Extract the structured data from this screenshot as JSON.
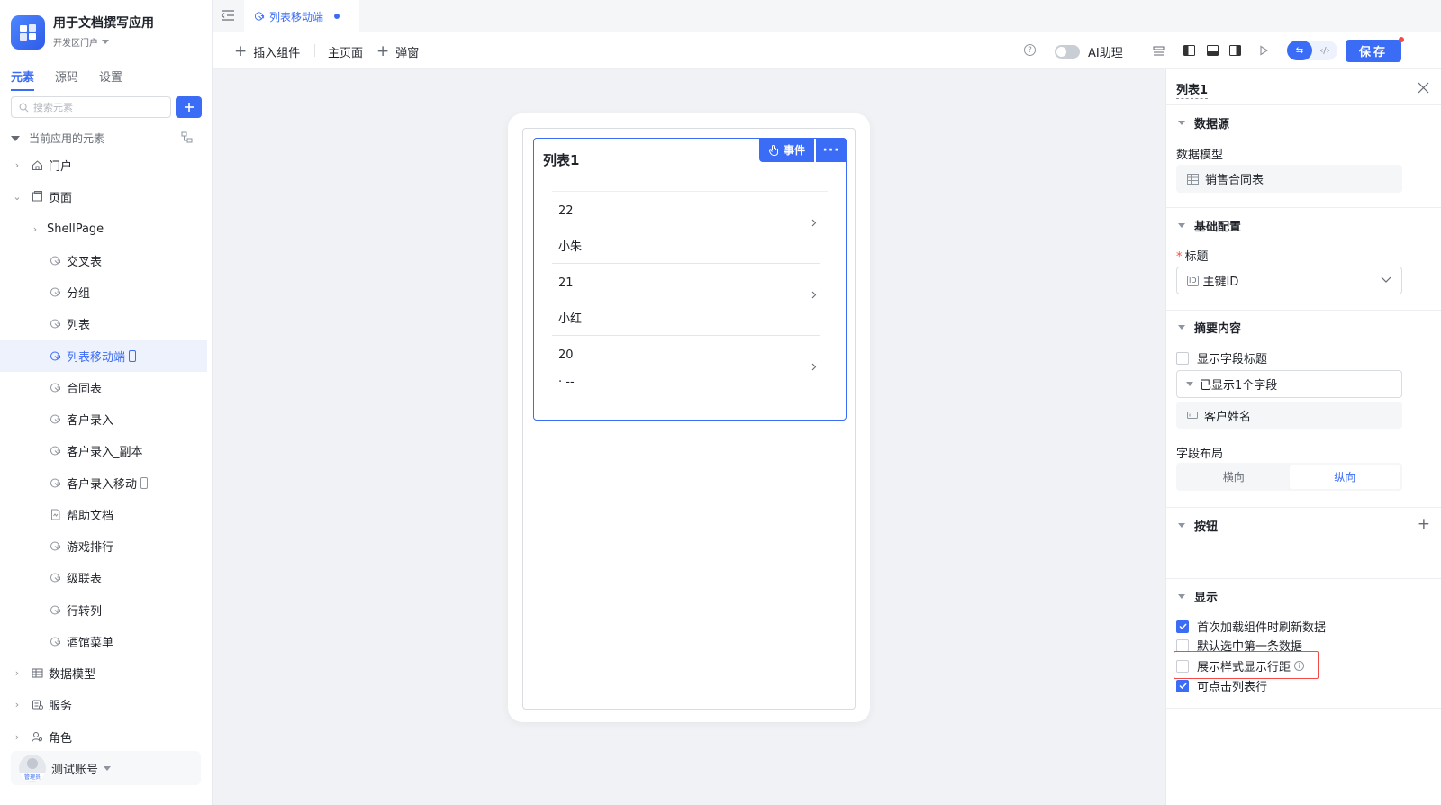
{
  "app": {
    "title": "用于文档撰写应用",
    "env": "开发区门户"
  },
  "sidebar": {
    "tabs": [
      "元素",
      "源码",
      "设置"
    ],
    "search_placeholder": "搜索元素",
    "section_label": "当前应用的元素",
    "items": [
      {
        "label": "门户",
        "icon": "home-icon"
      },
      {
        "label": "页面",
        "icon": "page-icon"
      },
      {
        "label": "ShellPage",
        "icon": ""
      },
      {
        "label": "交叉表",
        "icon": "page-leaf-icon"
      },
      {
        "label": "分组",
        "icon": "page-leaf-icon"
      },
      {
        "label": "列表",
        "icon": "page-leaf-icon"
      },
      {
        "label": "列表移动端",
        "icon": "page-leaf-icon"
      },
      {
        "label": "合同表",
        "icon": "page-leaf-icon"
      },
      {
        "label": "客户录入",
        "icon": "page-leaf-icon"
      },
      {
        "label": "客户录入_副本",
        "icon": "page-leaf-icon"
      },
      {
        "label": "客户录入移动",
        "icon": "page-leaf-icon"
      },
      {
        "label": "帮助文档",
        "icon": "document-icon"
      },
      {
        "label": "游戏排行",
        "icon": "page-leaf-icon"
      },
      {
        "label": "级联表",
        "icon": "page-leaf-icon"
      },
      {
        "label": "行转列",
        "icon": "page-leaf-icon"
      },
      {
        "label": "酒馆菜单",
        "icon": "page-leaf-icon"
      },
      {
        "label": "数据模型",
        "icon": "table-icon"
      },
      {
        "label": "服务",
        "icon": "service-icon"
      },
      {
        "label": "角色",
        "icon": "role-icon"
      }
    ],
    "user": {
      "name": "测试账号",
      "role_badge": "管理员"
    }
  },
  "topbar": {
    "tab_label": "列表移动端"
  },
  "toolbar": {
    "insert_component": "插入组件",
    "main_page": "主页面",
    "popup": "弹窗",
    "ai_assistant": "AI助理",
    "ai_assistant_enabled": false,
    "save": "保存"
  },
  "canvas": {
    "list_title": "列表1",
    "event_button": "事件",
    "more_button": "···",
    "rows": [
      {
        "id": "22",
        "name": "小朱"
      },
      {
        "id": "21",
        "name": "小红"
      },
      {
        "id": "20",
        "name": "· --"
      }
    ]
  },
  "panel": {
    "title": "列表1",
    "datasource": {
      "section": "数据源",
      "model_label": "数据模型",
      "model_value": "销售合同表"
    },
    "basic": {
      "section": "基础配置",
      "title_label": "标题",
      "title_value": "主键ID",
      "title_badge": "ID"
    },
    "summary": {
      "section": "摘要内容",
      "show_field_title": "显示字段标题",
      "show_field_title_checked": false,
      "shown_fields": "已显示1个字段",
      "field_item": "客户姓名",
      "layout_label": "字段布局",
      "layout_options": [
        "横向",
        "纵向"
      ],
      "layout_selected": "纵向"
    },
    "buttons": {
      "section": "按钮"
    },
    "display": {
      "section": "显示",
      "options": [
        {
          "label": "首次加载组件时刷新数据",
          "checked": true
        },
        {
          "label": "默认选中第一条数据",
          "checked": false
        },
        {
          "label": "展示样式显示行距",
          "checked": false
        },
        {
          "label": "可点击列表行",
          "checked": true
        }
      ]
    }
  },
  "colors": {
    "accent": "#3b6cf6",
    "highlight": "#f54a45"
  }
}
